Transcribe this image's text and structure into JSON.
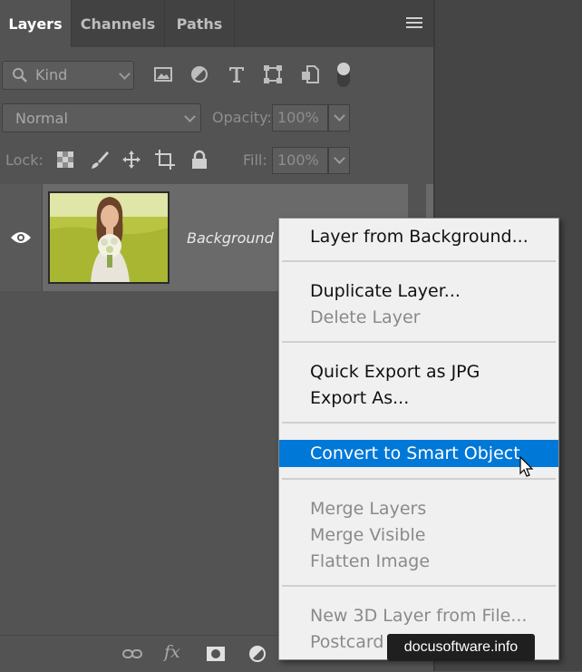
{
  "tabs": [
    {
      "label": "Layers",
      "active": true
    },
    {
      "label": "Channels",
      "active": false
    },
    {
      "label": "Paths",
      "active": false
    }
  ],
  "filter": {
    "kind_label": "Kind",
    "icons": [
      "image-filter-icon",
      "adjustment-filter-icon",
      "type-filter-icon",
      "shape-filter-icon",
      "smart-object-filter-icon",
      "filter-toggle-icon"
    ]
  },
  "blend": {
    "mode": "Normal",
    "opacity_label": "Opacity:",
    "opacity_value": "100%"
  },
  "lock": {
    "label": "Lock:",
    "fill_label": "Fill:",
    "fill_value": "100%"
  },
  "layer": {
    "name": "Background",
    "visible": true
  },
  "context_menu": {
    "items": [
      {
        "label": "Layer from Background...",
        "enabled": true
      },
      {
        "label": "Duplicate Layer...",
        "enabled": true
      },
      {
        "label": "Delete Layer",
        "enabled": false
      },
      {
        "label": "Quick Export as JPG",
        "enabled": true
      },
      {
        "label": "Export As...",
        "enabled": true
      },
      {
        "label": "Convert to Smart Object",
        "enabled": true,
        "highlighted": true
      },
      {
        "label": "Merge Layers",
        "enabled": false
      },
      {
        "label": "Merge Visible",
        "enabled": false
      },
      {
        "label": "Flatten Image",
        "enabled": false
      },
      {
        "label": "New 3D Layer from File...",
        "enabled": false
      },
      {
        "label": "Postcard",
        "enabled": false
      }
    ]
  },
  "bottom_toolbar": {
    "fx_label": "fx",
    "icons": [
      "link-layers-icon",
      "fx-icon",
      "layer-mask-icon",
      "adjustment-layer-icon",
      "group-icon",
      "new-layer-icon",
      "delete-layer-icon"
    ]
  },
  "watermark": "docusoftware.info",
  "colors": {
    "panel_bg": "#535353",
    "tab_bar_bg": "#424242",
    "menu_bg": "#f0f0f0",
    "menu_highlight": "#0078d7",
    "disabled_text": "#8a8a8a"
  }
}
